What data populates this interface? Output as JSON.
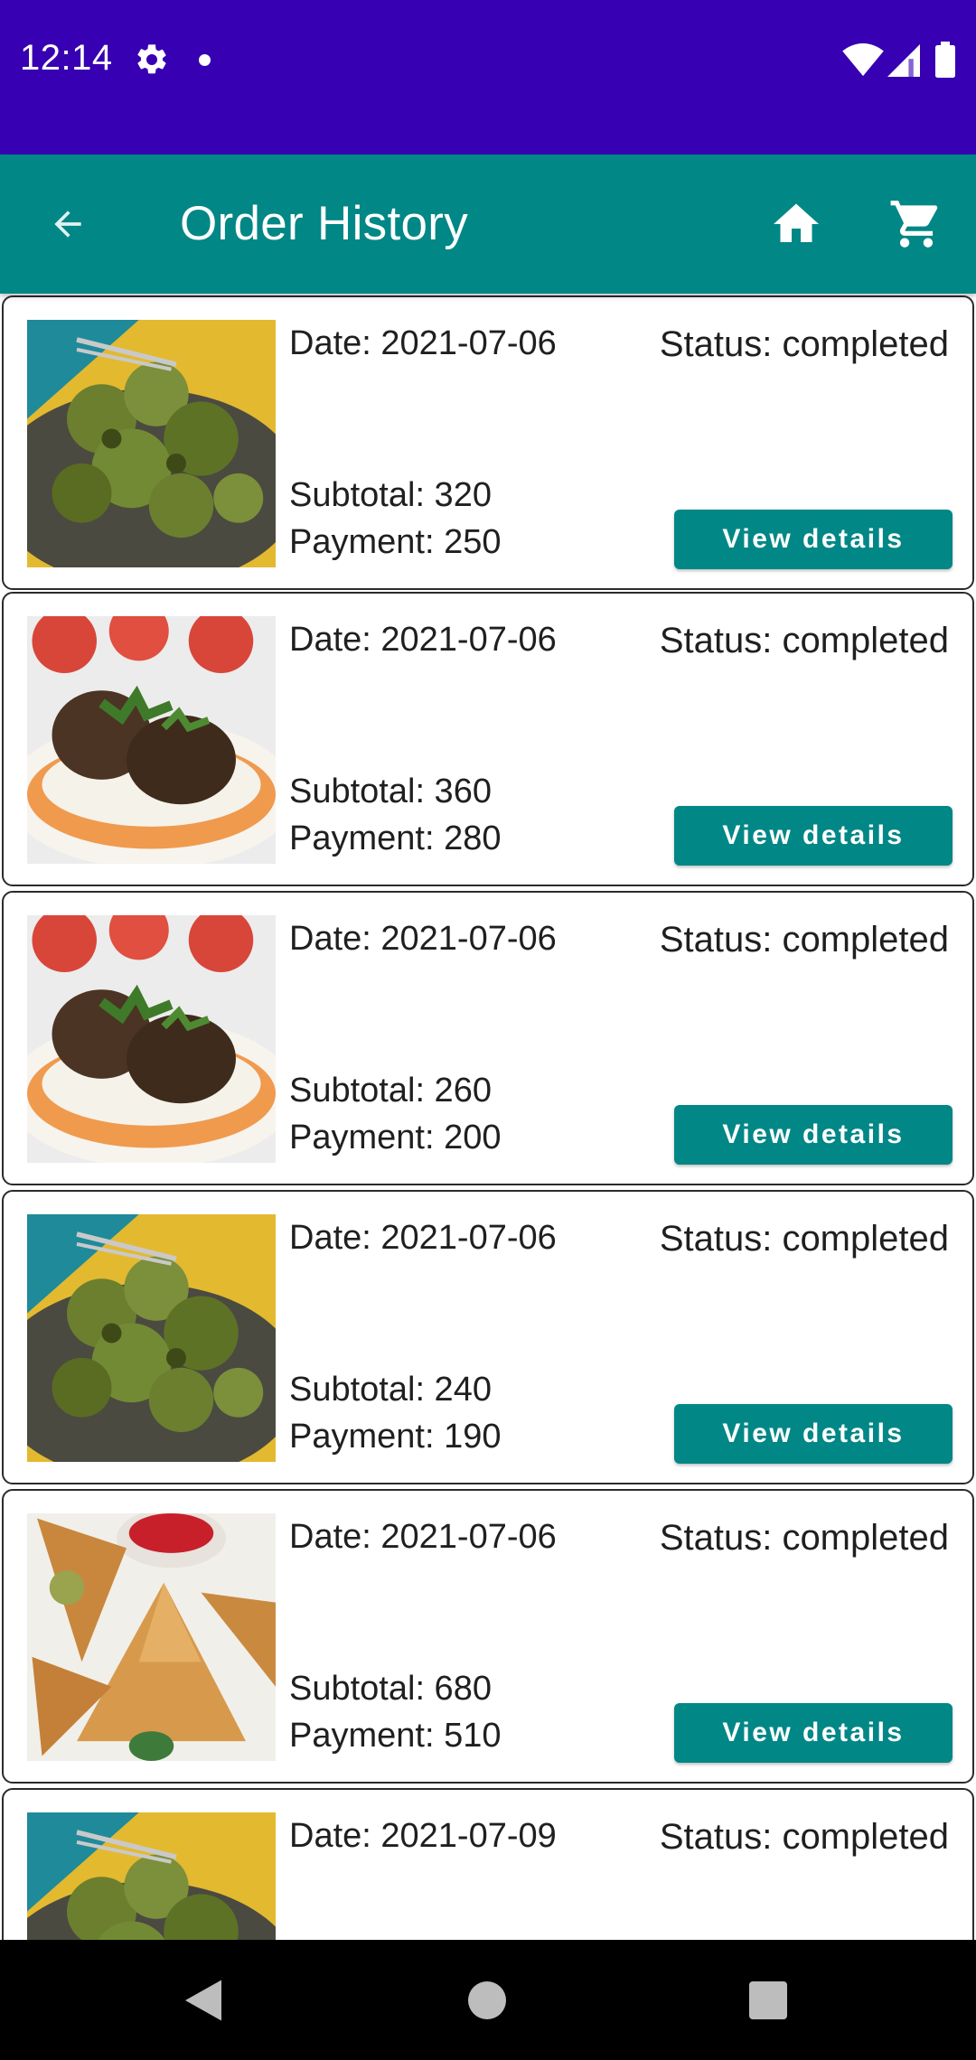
{
  "status_bar": {
    "time": "12:14",
    "icons": [
      "gear-icon",
      "notification-dot-icon",
      "wifi-icon",
      "signal-icon",
      "battery-icon"
    ]
  },
  "app_bar": {
    "title": "Order History",
    "back_icon": "arrow-left-icon",
    "home_icon": "home-icon",
    "cart_icon": "cart-icon"
  },
  "orders": [
    {
      "image": "green-kebab",
      "date": "Date: 2021-07-06",
      "status": "Status: completed",
      "subtotal": "Subtotal: 320",
      "payment": "Payment: 250",
      "button": "View details"
    },
    {
      "image": "cutlet-plate",
      "date": "Date: 2021-07-06",
      "status": "Status: completed",
      "subtotal": "Subtotal: 360",
      "payment": "Payment: 280",
      "button": "View details"
    },
    {
      "image": "cutlet-plate",
      "date": "Date: 2021-07-06",
      "status": "Status: completed",
      "subtotal": "Subtotal: 260",
      "payment": "Payment: 200",
      "button": "View details"
    },
    {
      "image": "green-kebab",
      "date": "Date: 2021-07-06",
      "status": "Status: completed",
      "subtotal": "Subtotal: 240",
      "payment": "Payment: 190",
      "button": "View details"
    },
    {
      "image": "samosa",
      "date": "Date: 2021-07-06",
      "status": "Status: completed",
      "subtotal": "Subtotal: 680",
      "payment": "Payment: 510",
      "button": "View details"
    },
    {
      "image": "green-kebab",
      "date": "Date: 2021-07-09",
      "status": "Status: completed"
    }
  ],
  "nav_bar": {
    "icons": [
      "nav-back-icon",
      "nav-home-icon",
      "nav-recents-icon"
    ]
  },
  "colors": {
    "status_bar": "#3700b3",
    "app_bar": "#018786",
    "button": "#018786"
  }
}
